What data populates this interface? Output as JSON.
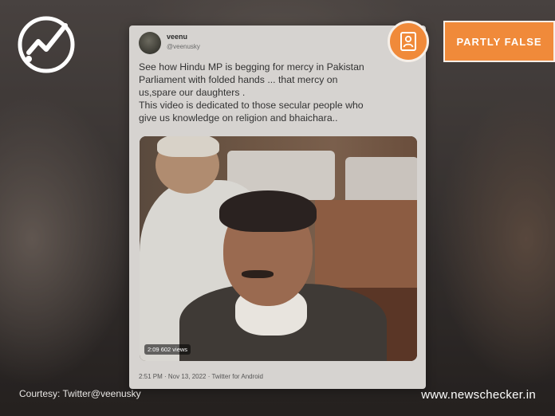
{
  "tweet": {
    "username": "veenu",
    "handle": "@veenusky",
    "text_lines": [
      "See how Hindu MP is begging for mercy in Pakistan",
      "Parliament with folded hands ... that mercy on",
      "us,spare our daughters .",
      "This video is dedicated to  those secular  people who",
      "give us knowledge on religion and bhaichara.."
    ],
    "video": {
      "duration": "2:09",
      "views": "602 views"
    },
    "meta": "2:51 PM · Nov 13, 2022 · Twitter for Android"
  },
  "verdict": {
    "label": "PARTLY FALSE",
    "color": "#f08a3a",
    "icon": "document-person-icon"
  },
  "logo": {
    "icon": "newschecker-check-logo"
  },
  "footer": {
    "courtesy": "Courtesy: Twitter@veenusky",
    "site": "www.newschecker.in"
  }
}
